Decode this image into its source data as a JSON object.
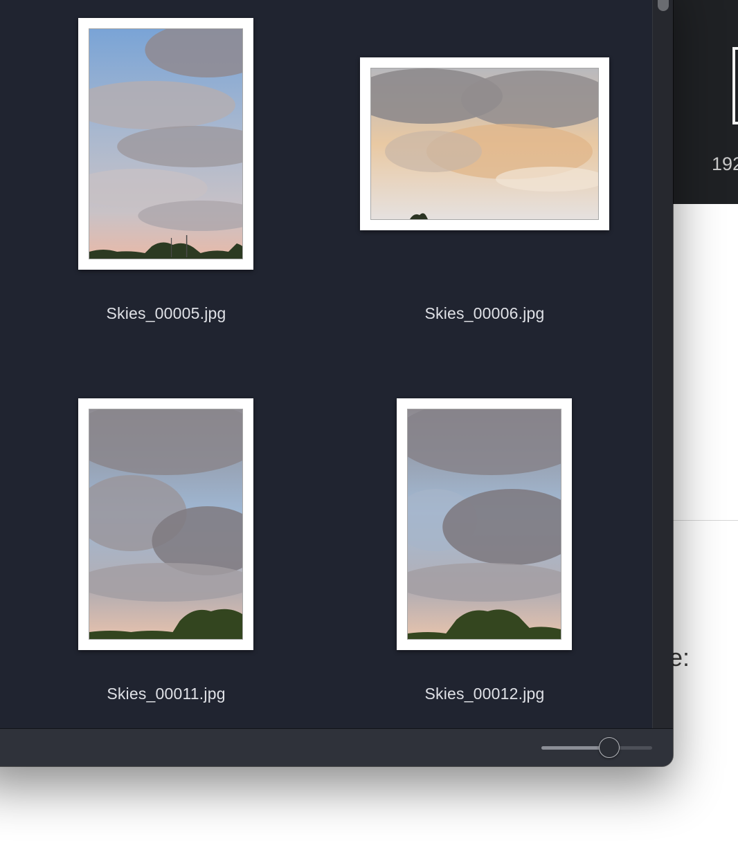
{
  "background_app": {
    "dimension_text": "192",
    "field_label": "e:"
  },
  "files": [
    {
      "name": "Skies_00005.jpg",
      "icon": "image-thumbnail-icon"
    },
    {
      "name": "Skies_00006.jpg",
      "icon": "image-thumbnail-icon"
    },
    {
      "name": "Skies_00011.jpg",
      "icon": "image-thumbnail-icon"
    },
    {
      "name": "Skies_00012.jpg",
      "icon": "image-thumbnail-icon"
    }
  ],
  "icon_size_slider": {
    "value": 0.61
  },
  "colors": {
    "window_background": "#202430",
    "status_bar": "#2f323a",
    "label_text": "#dfe1e6"
  }
}
